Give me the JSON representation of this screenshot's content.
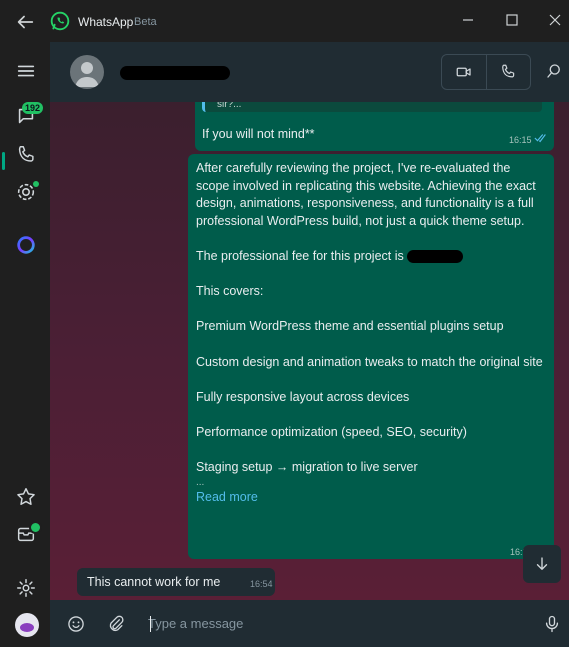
{
  "window": {
    "title": "WhatsApp",
    "subtitle": "Beta"
  },
  "sidebar": {
    "chats_badge": "192"
  },
  "chat": {
    "outgoing_1": {
      "quoted_text": "sir?...",
      "text": "If you will not mind**",
      "time": "16:15"
    },
    "outgoing_2": {
      "paragraphs": [
        "After carefully reviewing the project, I've re-evaluated the scope involved in replicating this website. Achieving the exact design, animations, responsiveness, and functionality is a full professional WordPress build, not just a quick theme setup.",
        "The professional fee for this project is",
        "This covers:",
        "Premium WordPress theme and essential plugins setup",
        "Custom design and animation tweaks to match the original site",
        "Fully responsive layout across devices",
        "Performance optimization (speed, SEO, security)",
        "Staging setup → migration to live server"
      ],
      "ellipsis": "...",
      "read_more": "Read more",
      "time": "16:2"
    },
    "incoming_1": {
      "text": "This cannot work for me",
      "time": "16:54"
    }
  },
  "composer": {
    "placeholder": "Type a message"
  },
  "colors": {
    "accent": "#00a884",
    "outgoing_bubble": "#005c4b",
    "incoming_bubble": "#202c33",
    "link": "#53bdeb"
  }
}
